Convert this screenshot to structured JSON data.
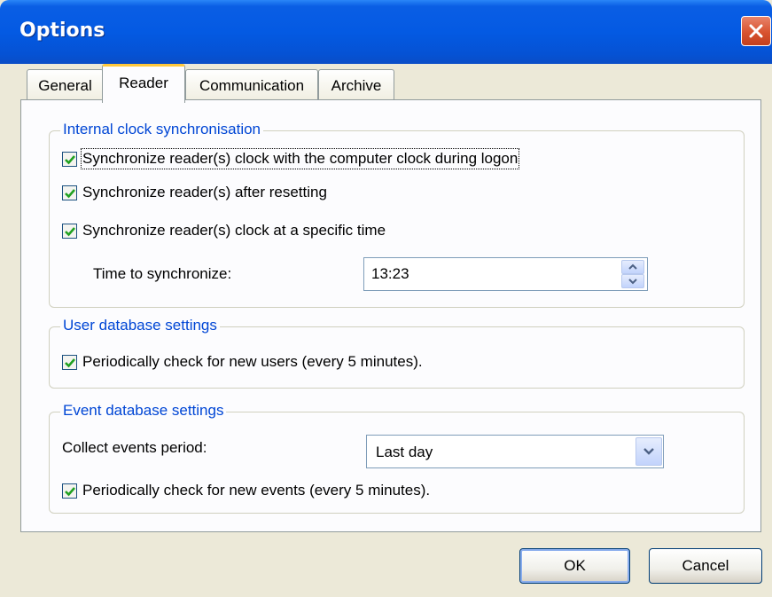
{
  "window": {
    "title": "Options"
  },
  "tabs": [
    {
      "label": "General",
      "active": false
    },
    {
      "label": "Reader",
      "active": true
    },
    {
      "label": "Communication",
      "active": false
    },
    {
      "label": "Archive",
      "active": false
    }
  ],
  "clock_group": {
    "title": "Internal clock synchronisation",
    "checkboxes": [
      {
        "label": "Synchronize reader(s) clock with the computer clock during logon",
        "checked": true
      },
      {
        "label": "Synchronize reader(s) after resetting",
        "checked": true
      },
      {
        "label": "Synchronize reader(s) clock at a specific time",
        "checked": true
      }
    ],
    "time_label": "Time to synchronize:",
    "time_value": "13:23"
  },
  "user_group": {
    "title": "User database settings",
    "checkbox": {
      "label": "Periodically check for new users (every 5 minutes).",
      "checked": true
    }
  },
  "event_group": {
    "title": "Event database settings",
    "period_label": "Collect events period:",
    "period_value": "Last day",
    "checkbox": {
      "label": "Periodically check for new events (every 5 minutes).",
      "checked": true
    }
  },
  "buttons": {
    "ok": "OK",
    "cancel": "Cancel"
  },
  "colors": {
    "title_bar": "#0a5ee4",
    "group_title": "#0046d5",
    "check_mark": "#21a121"
  },
  "icons": [
    "close-icon",
    "check-icon",
    "spin-up-icon",
    "spin-down-icon",
    "chevron-down-icon"
  ]
}
